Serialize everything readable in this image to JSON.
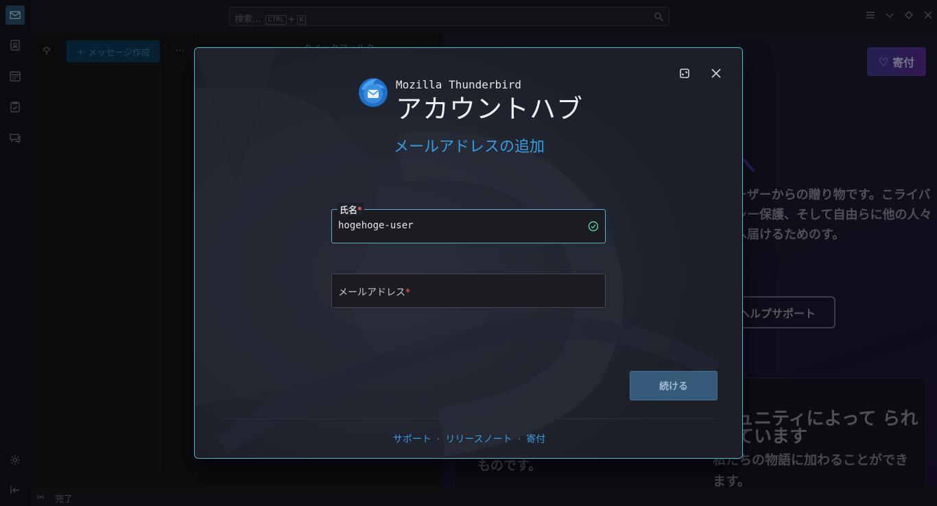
{
  "topbar": {
    "search_placeholder": "検索...",
    "kbd_ctrl": "CTRL",
    "kbd_plus": "+",
    "kbd_k": "K"
  },
  "folderpane": {
    "new_message_label": "＋ メッセージ作成",
    "more_label": "⋯"
  },
  "threadpane": {
    "quick_filter_label": "クイックフィルター"
  },
  "startpage": {
    "donate_label": "寄付",
    "heading_fragment": "へ",
    "paragraph": "ーザーからの贈り物です。こライバシー保護、そして自由らに他の人々へ届けるためのす。",
    "help_button": "ヘルプサポート",
    "card_heading": "ュニティによって られています",
    "card_text": "私たちの物語に加わることができます。",
    "card_text_left": "ものです。"
  },
  "statusbar": {
    "status_text": "完了"
  },
  "dialog": {
    "brand_small": "Mozilla Thunderbird",
    "brand_big": "アカウントハブ",
    "subtitle": "メールアドレスの追加",
    "name_field": {
      "label": "氏名",
      "required_mark": "*",
      "value": "hogehoge-user"
    },
    "email_field": {
      "label": "メールアドレス",
      "required_mark": "*",
      "value": ""
    },
    "continue_button": "続ける",
    "footer": {
      "support": "サポート",
      "release_notes": "リリースノート",
      "donate": "寄付",
      "separator": "·"
    }
  },
  "colors": {
    "accent": "#3a9ce0",
    "dialog_border": "#4ab8de",
    "required": "#ff5a5a",
    "continue_bg": "#365b7a"
  },
  "icons": {
    "spaces": [
      "mail-icon",
      "address-book-icon",
      "calendar-icon",
      "tasks-icon",
      "chat-icon"
    ],
    "bottom": [
      "settings-gear-icon",
      "collapse-spaces-icon"
    ]
  }
}
